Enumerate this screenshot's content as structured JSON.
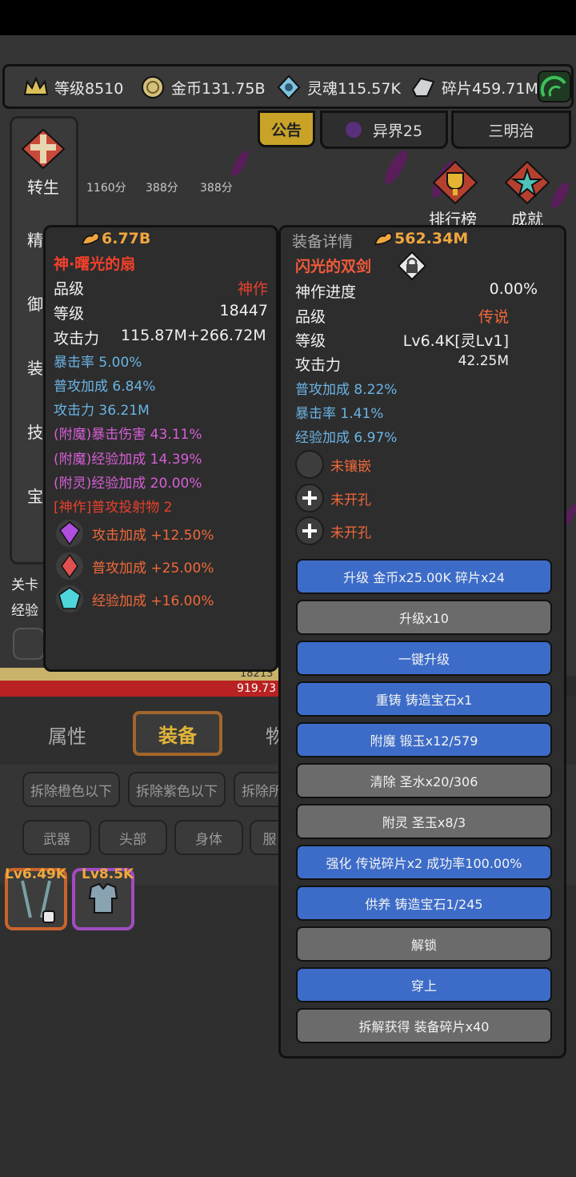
{
  "resources": {
    "level": "等级8510",
    "gold": "金币131.75B",
    "soul": "灵魂115.57K",
    "fragments": "碎片459.71M"
  },
  "top_tabs": {
    "notice": "公告",
    "otherworld": "异界25",
    "sanming": "三明治"
  },
  "side_menu": {
    "rebirth": "转生",
    "refine": "精",
    "defend": "御",
    "equip": "装",
    "skill": "技",
    "treasure": "宝",
    "ranking": "排行榜",
    "achievement": "成就",
    "stage": "关卡",
    "exp": "经验"
  },
  "scores": [
    "1160分",
    "388分",
    "388分"
  ],
  "stat_bar_values": [
    "18213",
    "919.73"
  ],
  "left_item": {
    "power": "6.77B",
    "name": "神·曙光的扇",
    "quality_label": "品级",
    "quality_value": "神作",
    "level_label": "等级",
    "level_value": "18447",
    "attack_label": "攻击力",
    "attack_value": "115.87M+266.72M",
    "stats": [
      {
        "text": "暴击率 5.00%",
        "color": "blue"
      },
      {
        "text": "普攻加成 6.84%",
        "color": "blue"
      },
      {
        "text": "攻击力 36.21M",
        "color": "blue"
      },
      {
        "text": "(附魔)暴击伤害 43.11%",
        "color": "purple"
      },
      {
        "text": "(附魔)经验加成 14.39%",
        "color": "purple"
      },
      {
        "text": "(附灵)经验加成 20.00%",
        "color": "purple"
      },
      {
        "text": "[神作]普攻投射物 2",
        "color": "red"
      }
    ],
    "gems": [
      {
        "text": "攻击加成 +12.50%",
        "icon": "purple-gem-icon"
      },
      {
        "text": "普攻加成 +25.00%",
        "icon": "red-gem-icon"
      },
      {
        "text": "经验加成 +16.00%",
        "icon": "cyan-gem-icon"
      }
    ]
  },
  "right_item": {
    "header": "装备详情",
    "power": "562.34M",
    "name": "闪光的双剑",
    "progress_label": "神作进度",
    "progress_value": "0.00%",
    "quality_label": "品级",
    "quality_value": "传说",
    "level_label": "等级",
    "level_value": "Lv6.4K[灵Lv1]",
    "attack_label": "攻击力",
    "attack_value": "42.25M",
    "stats": [
      "普攻加成 8.22%",
      "暴击率 1.41%",
      "经验加成 6.97%"
    ],
    "sockets": [
      "未镶嵌",
      "未开孔",
      "未开孔"
    ],
    "buttons": [
      {
        "label": "升级 金币x25.00K 碎片x24",
        "style": "blue"
      },
      {
        "label": "升级x10",
        "style": "grey"
      },
      {
        "label": "一键升级",
        "style": "blue"
      },
      {
        "label": "重铸 铸造宝石x1",
        "style": "blue"
      },
      {
        "label": "附魔 锻玉x12/579",
        "style": "blue"
      },
      {
        "label": "清除 圣水x20/306",
        "style": "grey"
      },
      {
        "label": "附灵 圣玉x8/3",
        "style": "grey"
      },
      {
        "label": "强化 传说碎片x2 成功率100.00%",
        "style": "blue"
      },
      {
        "label": "供养 铸造宝石1/245",
        "style": "blue"
      },
      {
        "label": "解锁",
        "style": "grey"
      },
      {
        "label": "穿上",
        "style": "blue"
      },
      {
        "label": "拆解获得 装备碎片x40",
        "style": "grey"
      }
    ]
  },
  "bottom_tabs": {
    "attributes": "属性",
    "equipment": "装备",
    "items": "物"
  },
  "filters": [
    "拆除橙色以下",
    "拆除紫色以下",
    "拆除所"
  ],
  "categories": [
    "武器",
    "头部",
    "身体",
    "服"
  ],
  "inventory": [
    {
      "level": "Lv6.49K",
      "border": "#c8642c"
    },
    {
      "level": "Lv8.5K",
      "border": "#a04cc0"
    }
  ]
}
